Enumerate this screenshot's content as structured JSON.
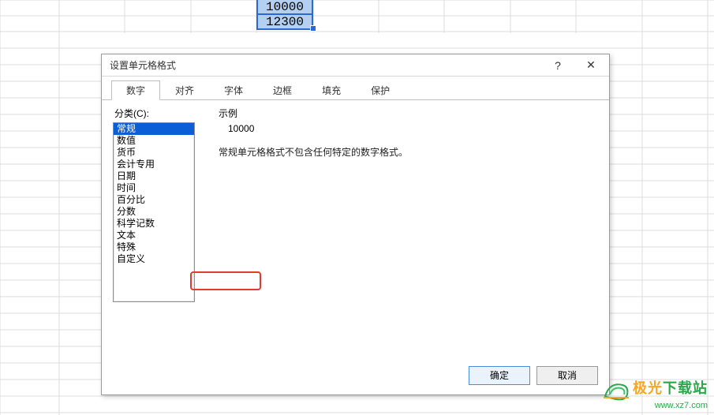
{
  "cells": {
    "A1": "10000",
    "A2": "12300"
  },
  "dialog": {
    "title": "设置单元格格式",
    "help": "?",
    "close": "✕",
    "tabs": [
      {
        "label": "数字",
        "active": true
      },
      {
        "label": "对齐",
        "active": false
      },
      {
        "label": "字体",
        "active": false
      },
      {
        "label": "边框",
        "active": false
      },
      {
        "label": "填充",
        "active": false
      },
      {
        "label": "保护",
        "active": false
      }
    ],
    "category_label": "分类(C):",
    "categories": [
      {
        "label": "常规",
        "selected": true
      },
      {
        "label": "数值",
        "selected": false
      },
      {
        "label": "货币",
        "selected": false
      },
      {
        "label": "会计专用",
        "selected": false
      },
      {
        "label": "日期",
        "selected": false
      },
      {
        "label": "时间",
        "selected": false
      },
      {
        "label": "百分比",
        "selected": false
      },
      {
        "label": "分数",
        "selected": false
      },
      {
        "label": "科学记数",
        "selected": false
      },
      {
        "label": "文本",
        "selected": false
      },
      {
        "label": "特殊",
        "selected": false
      },
      {
        "label": "自定义",
        "selected": false
      }
    ],
    "highlighted_category_index": 11,
    "sample_label": "示例",
    "sample_value": "10000",
    "description": "常规单元格格式不包含任何特定的数字格式。",
    "ok": "确定",
    "cancel": "取消"
  },
  "watermark": {
    "site_name_1": "极光",
    "site_name_2": "下载站",
    "url": "www.xz7.com"
  }
}
